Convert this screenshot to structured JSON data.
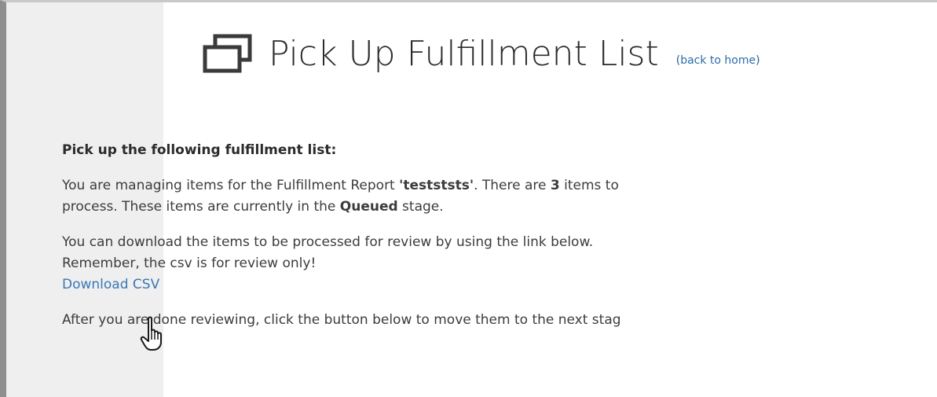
{
  "header": {
    "title": "Pick Up Fulfillment List",
    "back_prefix": "(",
    "back_label": "back to home",
    "back_suffix": ")",
    "icon": "windows-icon"
  },
  "content": {
    "heading": "Pick up the following fulfillment list:",
    "para1": {
      "t1": "You are managing items for the Fulfillment Report ",
      "report_name": "'testststs'",
      "t2": ". There are ",
      "count": "3",
      "t3": " items to",
      "t4": "process. These items are currently in the ",
      "stage": "Queued",
      "t5": " stage."
    },
    "para2": {
      "line1": "You can download the items to be processed for review by using the link below.",
      "line2": "Remember, the csv is for review only!",
      "download_label": "Download CSV"
    },
    "para3": "After you are done reviewing, click the button below to move them to the next stag"
  },
  "colors": {
    "link": "#3a77b5",
    "sidebar": "#efefef",
    "frame": "#8f8f8f"
  },
  "cursor_icon": "hand-pointer-icon"
}
